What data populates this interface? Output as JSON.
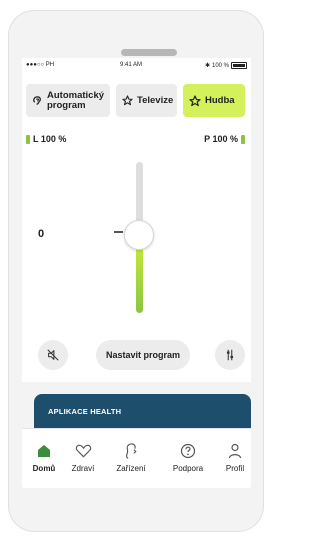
{
  "status_bar": {
    "carrier": "●●●○○ PH",
    "time": "9:41 AM",
    "battery": "100 %"
  },
  "programs": [
    {
      "label": "Automatický program",
      "icon": "auto-program-icon"
    },
    {
      "label": "Televize",
      "icon": "star-icon"
    },
    {
      "label": "Hudba",
      "icon": "star-icon",
      "active": true
    },
    {
      "label": "",
      "icon": "more-icon"
    }
  ],
  "battery": {
    "left": "L 100 %",
    "right": "P 100 %"
  },
  "volume": {
    "value": "0",
    "level": 0.5
  },
  "controls": {
    "program_button": "Nastavit program"
  },
  "health_banner": {
    "title": "APLIKACE HEALTH"
  },
  "nav": {
    "home": "Domů",
    "health": "Zdraví",
    "devices": "Zařízení",
    "support": "Podpora",
    "profile": "Profil"
  },
  "colors": {
    "accent": "#d4f05b",
    "slider": "#8bc53f",
    "banner": "#1d4e6b",
    "home_icon": "#3a8d3a"
  }
}
